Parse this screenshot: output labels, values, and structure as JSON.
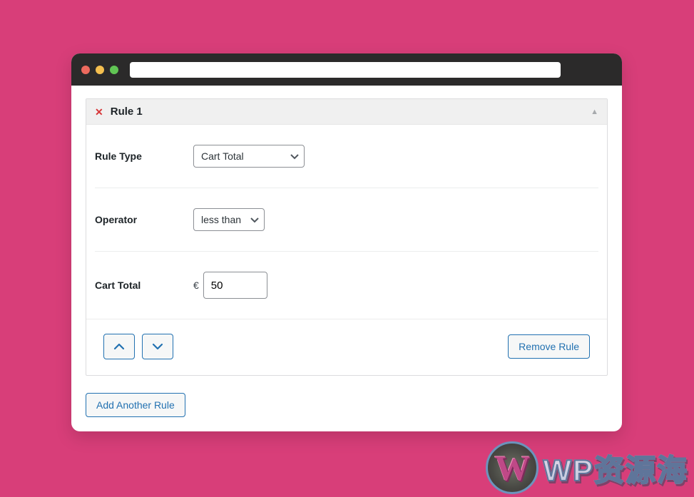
{
  "rule": {
    "title": "Rule 1",
    "type_label": "Rule Type",
    "type_value": "Cart Total",
    "operator_label": "Operator",
    "operator_value": "less than",
    "total_label": "Cart Total",
    "currency": "€",
    "total_value": "50"
  },
  "buttons": {
    "remove": "Remove Rule",
    "add": "Add Another Rule"
  },
  "watermark": {
    "text": "WP资源海"
  }
}
